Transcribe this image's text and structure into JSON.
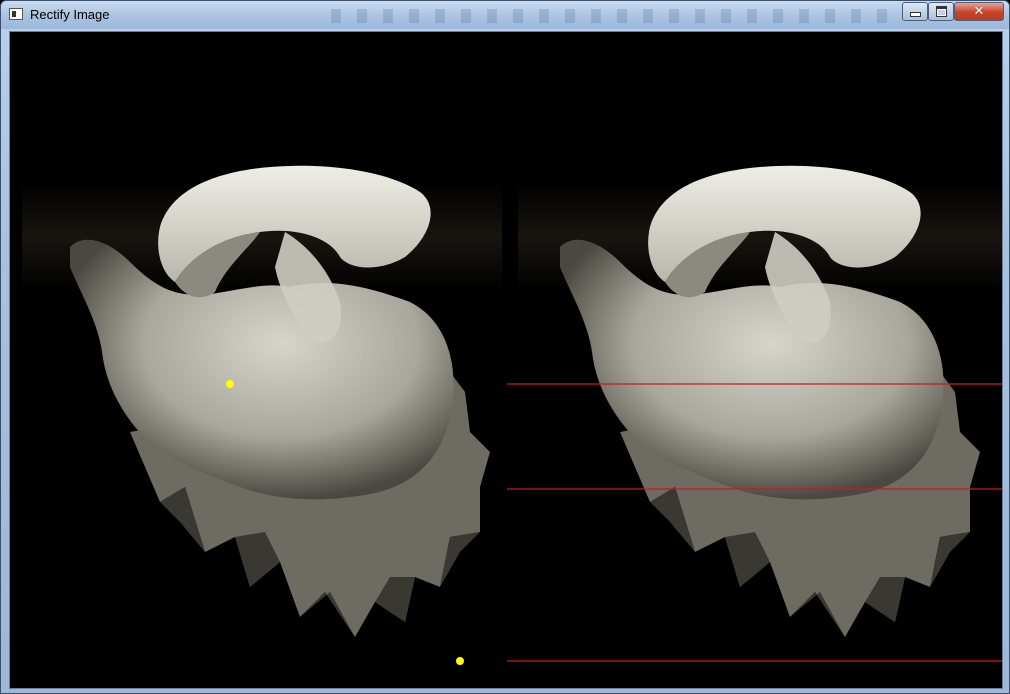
{
  "window": {
    "title": "Rectify Image",
    "controls": {
      "minimize": "minimize",
      "maximize": "maximize",
      "close": "close"
    },
    "icon": "app-window-icon"
  },
  "canvas": {
    "description_colors": {
      "background": "#000000",
      "epipolar_line": "#d01818",
      "marker_point": "#ffff00"
    }
  }
}
